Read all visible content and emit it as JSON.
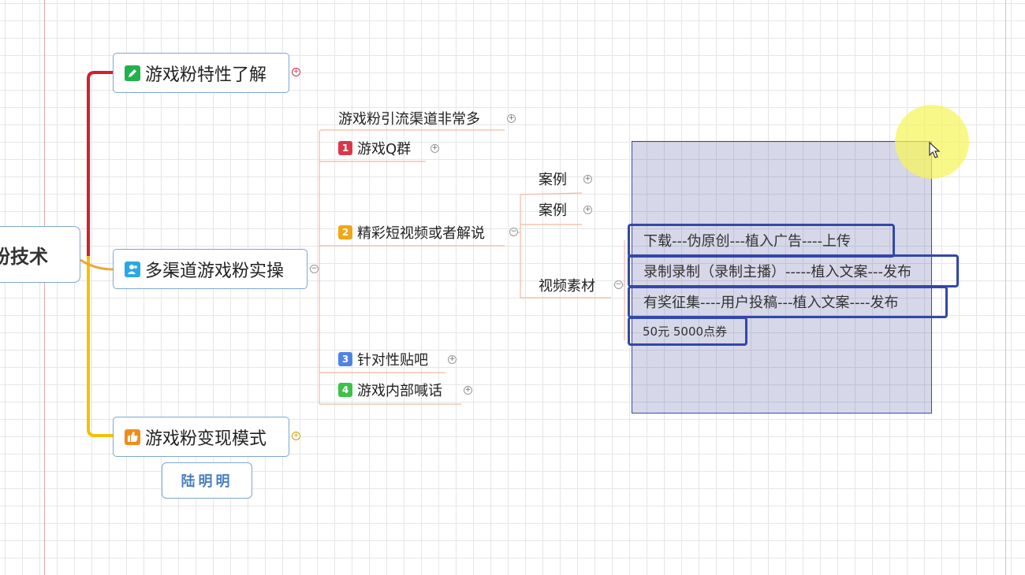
{
  "mindmap": {
    "central": "粉技术",
    "main_topics": [
      {
        "label": "游戏粉特性了解",
        "icon": "pencil-icon",
        "color": "#23b14d",
        "branch_color": "#d0202e"
      },
      {
        "label": "多渠道游戏粉实操",
        "icon": "people-icon",
        "color": "#2aa9e0",
        "branch_color": "#e8a93a"
      },
      {
        "label": "游戏粉变现模式",
        "icon": "thumbs-up-icon",
        "color": "#f08c1a",
        "branch_color": "#f2c200"
      }
    ],
    "channels": [
      {
        "label": "游戏粉引流渠道非常多",
        "badge": ""
      },
      {
        "label": "游戏Q群",
        "badge": "1",
        "badge_color": "#d9384a"
      },
      {
        "label": "精彩短视频或者解说",
        "badge": "2",
        "badge_color": "#f0a818"
      },
      {
        "label": "针对性贴吧",
        "badge": "3",
        "badge_color": "#4f84e6"
      },
      {
        "label": "游戏内部喊话",
        "badge": "4",
        "badge_color": "#3cc24a"
      }
    ],
    "video_children": [
      "案例",
      "案例",
      "视频素材"
    ],
    "material_items": [
      "下载---伪原创---植入广告----上传",
      "录制录制（录制主播）-----植入文案---发布",
      "有奖征集----用户投稿---植入文案----发布",
      "50元  5000点券"
    ],
    "signature": "陆明明"
  },
  "colors": {
    "highlight_border": "#3248a8",
    "selection_fill": "#d9dbe9",
    "topic_border": "#7ea6d3"
  }
}
